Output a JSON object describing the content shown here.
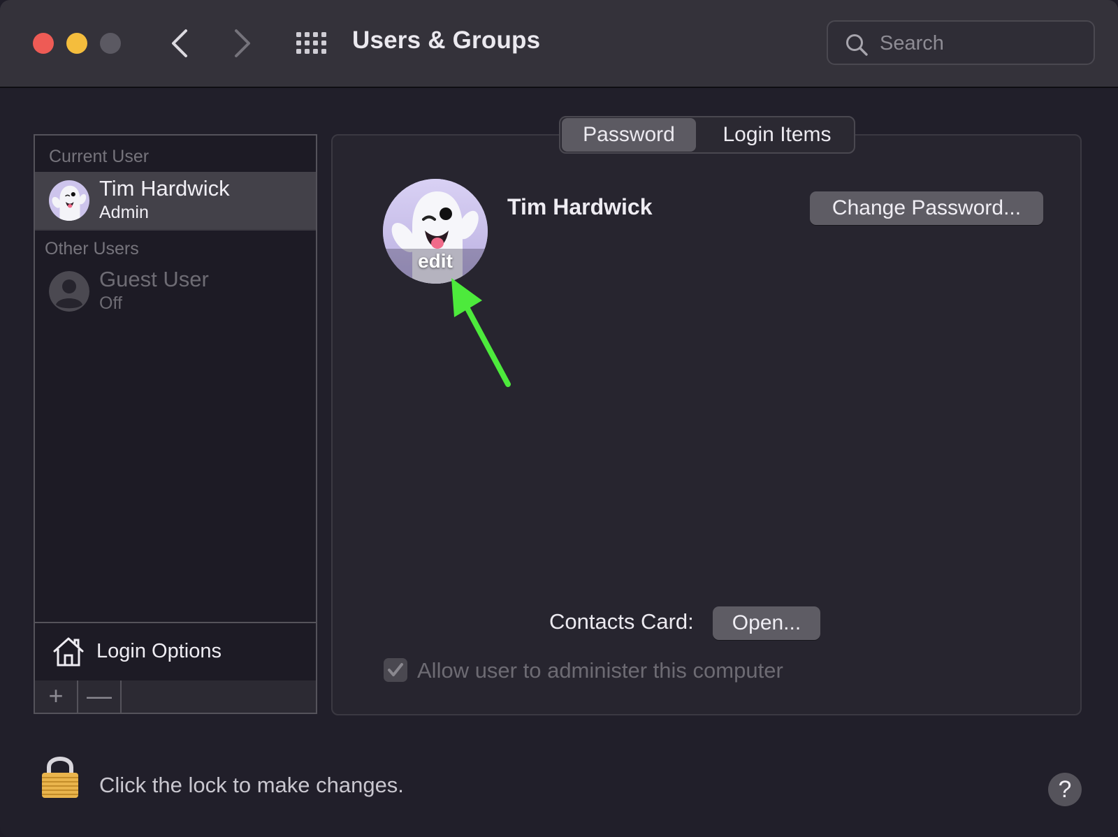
{
  "window": {
    "title": "Users & Groups",
    "search": {
      "placeholder": "Search",
      "value": ""
    }
  },
  "sidebar": {
    "current_user_label": "Current User",
    "other_users_label": "Other Users",
    "users": [
      {
        "name": "Tim Hardwick",
        "role": "Admin",
        "selected": true
      },
      {
        "name": "Guest User",
        "role": "Off",
        "selected": false
      }
    ],
    "login_options_label": "Login Options",
    "add_label": "+",
    "remove_label": "—"
  },
  "tabs": [
    {
      "label": "Password",
      "active": true
    },
    {
      "label": "Login Items",
      "active": false
    }
  ],
  "main": {
    "avatar_edit_label": "edit",
    "full_name": "Tim Hardwick",
    "change_password_label": "Change Password...",
    "contacts_card_label": "Contacts Card:",
    "open_label": "Open...",
    "allow_admin_label": "Allow user to administer this computer",
    "allow_admin_checked": true
  },
  "footer": {
    "lock_text": "Click the lock to make changes.",
    "help_label": "?"
  },
  "colors": {
    "arrow": "#4dea3c",
    "close": "#ee5b55",
    "minimize": "#f4bd3d"
  }
}
